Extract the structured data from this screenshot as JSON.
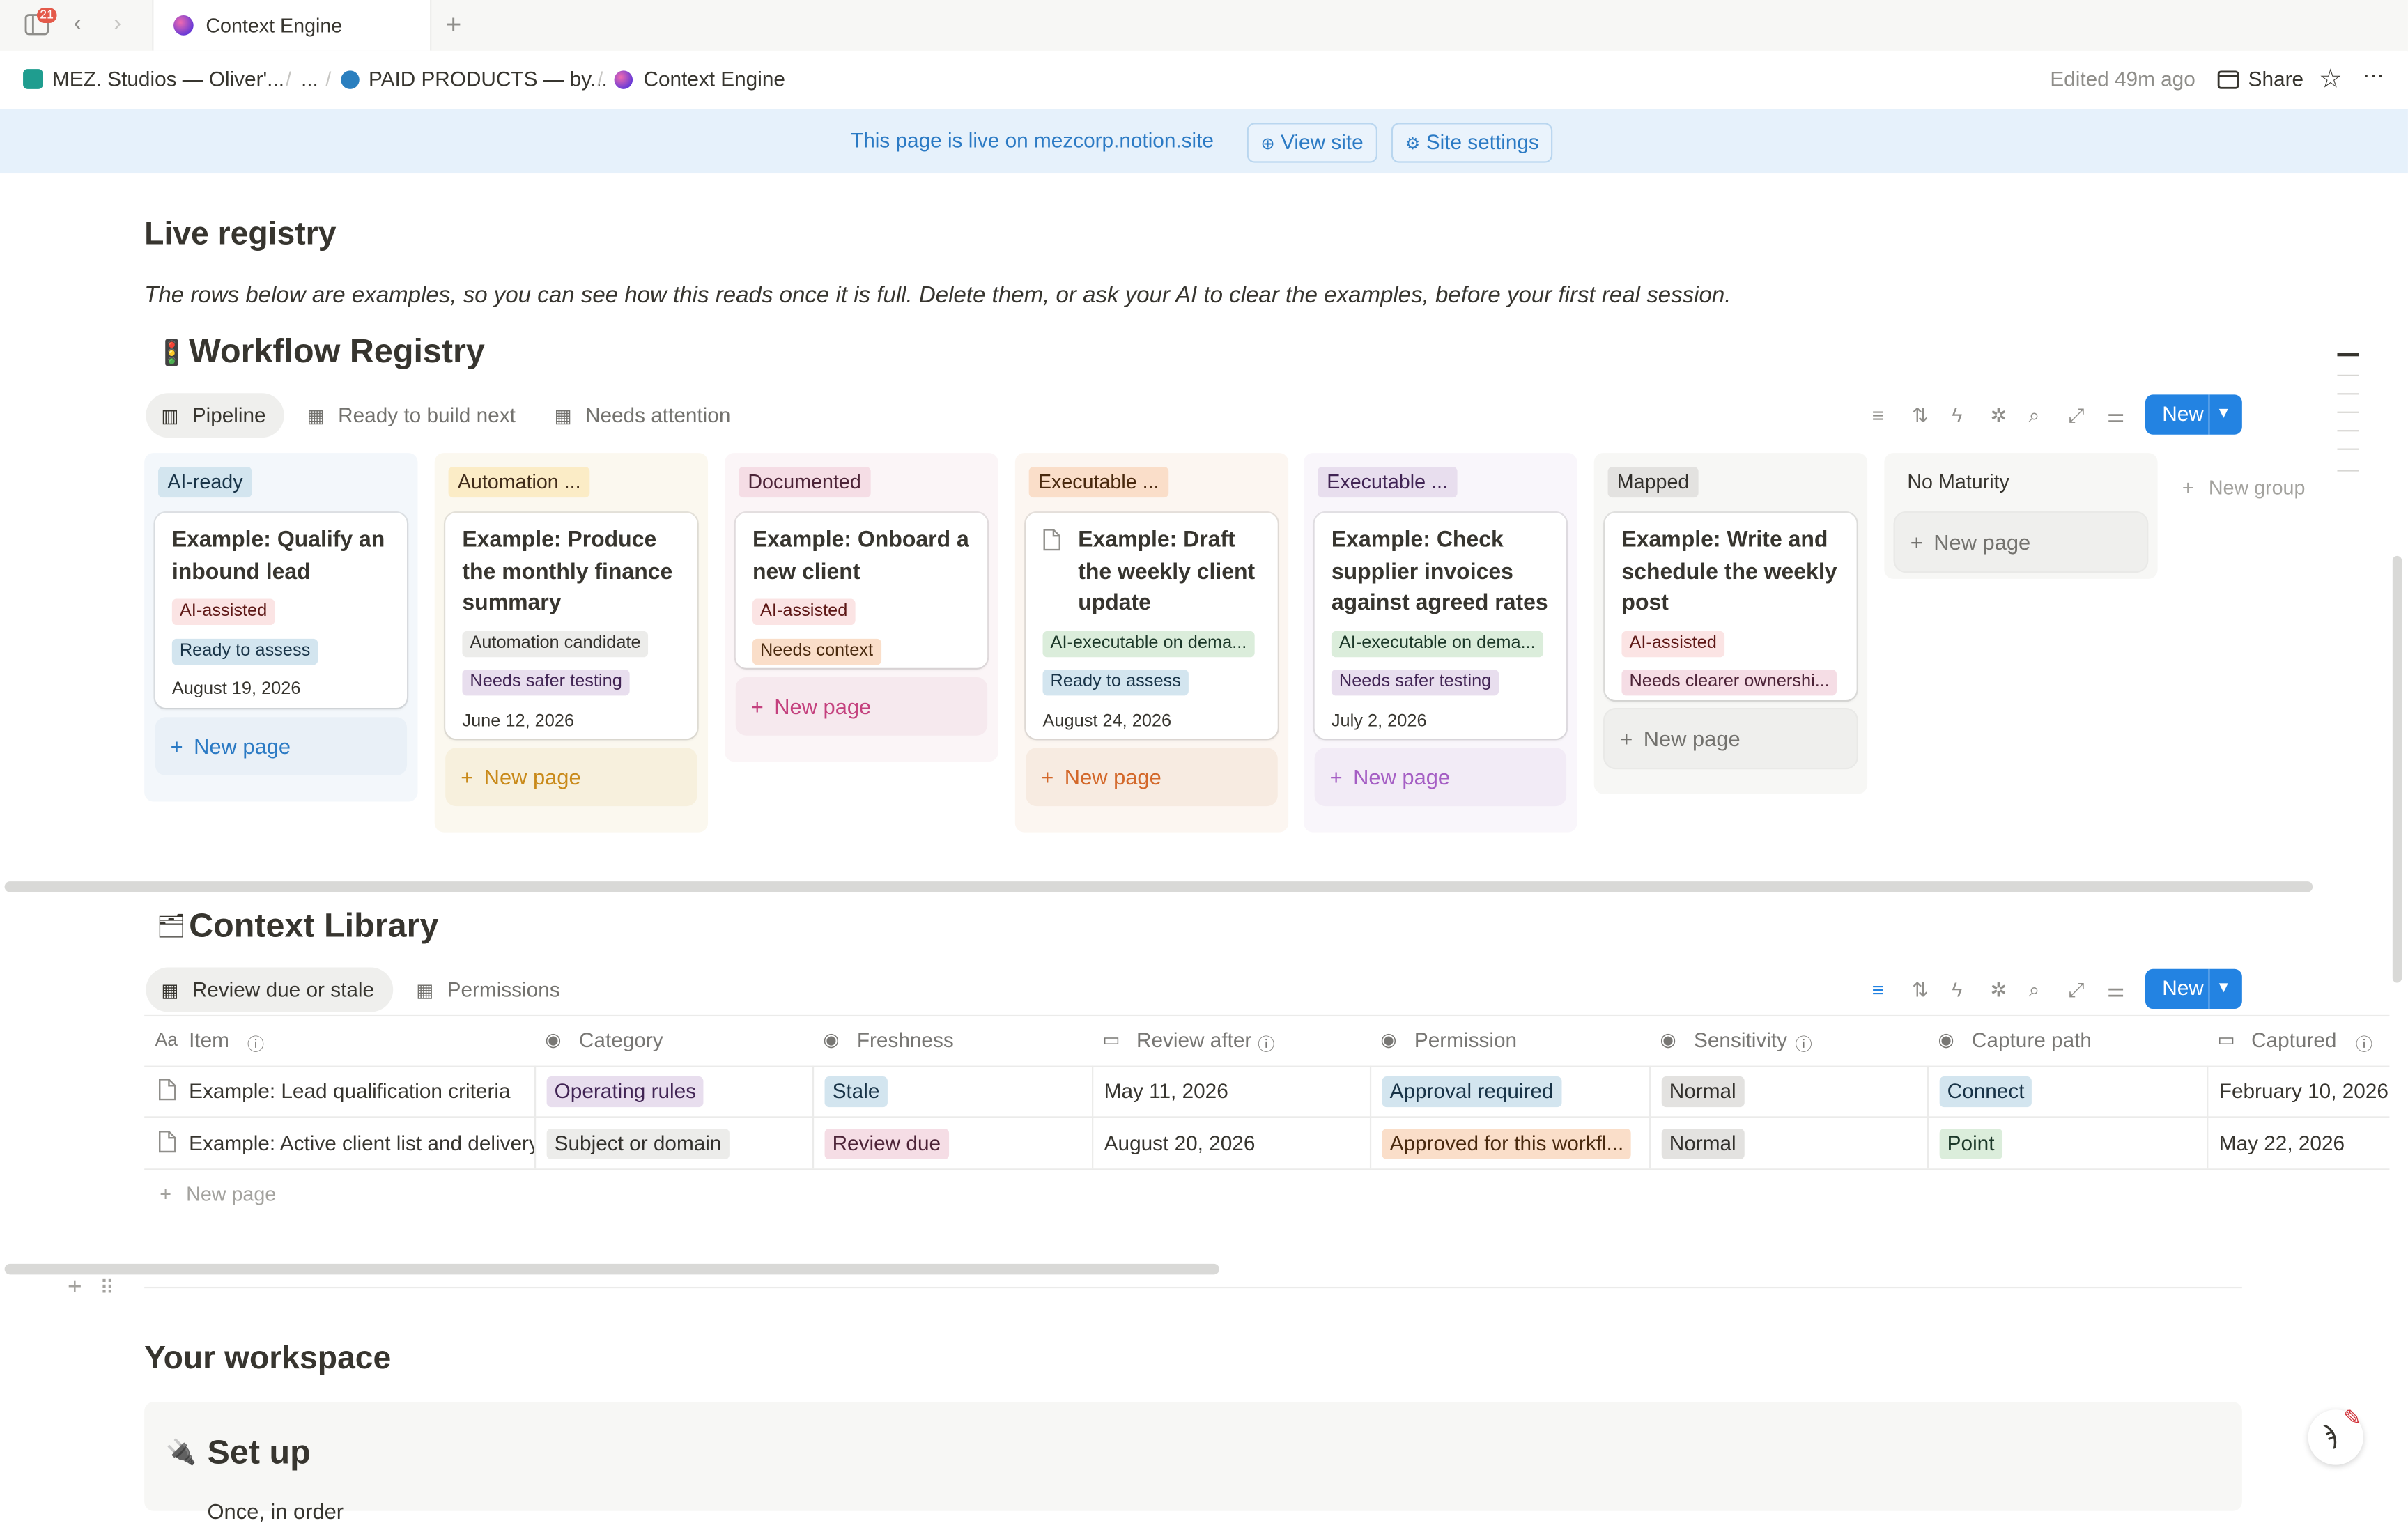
{
  "browser": {
    "notif_count": "21",
    "tab_title": "Context Engine",
    "new_tab": "+"
  },
  "breadcrumb": {
    "workspace": "MEZ. Studios — Oliver'...",
    "ellipsis": "...",
    "parent": "PAID PRODUCTS — by...",
    "current": "Context Engine",
    "edited": "Edited 49m ago",
    "share": "Share"
  },
  "banner": {
    "text": "This page is live on mezcorp.notion.site",
    "view_site": "View site",
    "site_settings": "Site settings"
  },
  "page": {
    "live_heading": "Live registry",
    "intro": "The rows below are examples, so you can see how this reads once it is full. Delete them, or ask your AI to clear the examples, before your first real session.",
    "workspace_heading": "Your workspace",
    "setup_heading": "Set up",
    "setup_line": "Once, in order"
  },
  "workflow": {
    "title": "Workflow Registry",
    "views": [
      "Pipeline",
      "Ready to build next",
      "Needs attention"
    ],
    "new_label": "New",
    "new_group": "New group",
    "new_page": "New page",
    "columns": [
      {
        "name": "AI-ready",
        "color": "#d3e5ef",
        "text": "#183347",
        "bg": "#f3f7fb",
        "cards": [
          {
            "title": "Example: Qualify an inbound lead",
            "tags": [
              [
                "AI-assisted",
                "#fbe4e4",
                "#5d1715"
              ],
              [
                "Ready to assess",
                "#d3e5ef",
                "#183347"
              ]
            ],
            "date": "August 19, 2026"
          }
        ]
      },
      {
        "name": "Automation ...",
        "color": "#fbecc6",
        "text": "#402c1b",
        "bg": "#fbf8ef",
        "cards": [
          {
            "title": "Example: Produce the monthly finance summary",
            "tags": [
              [
                "Automation candidate",
                "#ececea",
                "#32302c"
              ],
              [
                "Needs safer testing",
                "#e8deee",
                "#412454"
              ]
            ],
            "date": "June 12, 2026"
          }
        ]
      },
      {
        "name": "Documented",
        "color": "#f5dde5",
        "text": "#4c2337",
        "bg": "#fbf5f7",
        "cards": [
          {
            "title": "Example: Onboard a new client",
            "tags": [
              [
                "AI-assisted",
                "#fbe4e4",
                "#5d1715"
              ],
              [
                "Needs context",
                "#fadec9",
                "#49290e"
              ]
            ],
            "date": ""
          }
        ]
      },
      {
        "name": "Executable ...",
        "color": "#fadec9",
        "text": "#49290e",
        "bg": "#fcf6f1",
        "cards": [
          {
            "title": "Example: Draft the weekly client update",
            "tags": [
              [
                "AI-executable on dema...",
                "#dbeddb",
                "#1c3829"
              ],
              [
                "Ready to assess",
                "#d3e5ef",
                "#183347"
              ]
            ],
            "date": "August 24, 2026"
          }
        ]
      },
      {
        "name": "Executable ...",
        "color": "#e8deee",
        "text": "#412454",
        "bg": "#f9f6fb",
        "cards": [
          {
            "title": "Example: Check supplier invoices against agreed rates",
            "tags": [
              [
                "AI-executable on dema...",
                "#dbeddb",
                "#1c3829"
              ],
              [
                "Needs safer testing",
                "#e8deee",
                "#412454"
              ]
            ],
            "date": "July 2, 2026"
          }
        ]
      },
      {
        "name": "Mapped",
        "color": "#e3e2e0",
        "text": "#32302c",
        "bg": "#f7f7f5",
        "cards": [
          {
            "title": "Example: Write and schedule the weekly post",
            "tags": [
              [
                "AI-assisted",
                "#fbe4e4",
                "#5d1715"
              ],
              [
                "Needs clearer ownershi...",
                "#f5dde5",
                "#4c2337"
              ]
            ],
            "date": ""
          }
        ]
      },
      {
        "name": "No Maturity",
        "color": "transparent",
        "text": "#37352f",
        "bg": "#f7f7f5",
        "cards": []
      }
    ]
  },
  "library": {
    "title": "Context Library",
    "views": [
      "Review due or stale",
      "Permissions"
    ],
    "new_label": "New",
    "new_page": "New page",
    "columns": [
      "Item",
      "Category",
      "Freshness",
      "Review after",
      "Permission",
      "Sensitivity",
      "Capture path",
      "Captured"
    ],
    "rows": [
      {
        "item": "Example: Lead qualification criteria",
        "category": "Operating rules",
        "freshness": "Stale",
        "review_after": "May 11, 2026",
        "permission": "Approval required",
        "sensitivity": "Normal",
        "capture_path": "Connect",
        "captured": "February 10, 2026"
      },
      {
        "item": "Example: Active client list and delivery",
        "category": "Subject or domain",
        "freshness": "Review due",
        "review_after": "August 20, 2026",
        "permission": "Approved for this workfl...",
        "sensitivity": "Normal",
        "capture_path": "Point",
        "captured": "May 22, 2026"
      }
    ]
  }
}
